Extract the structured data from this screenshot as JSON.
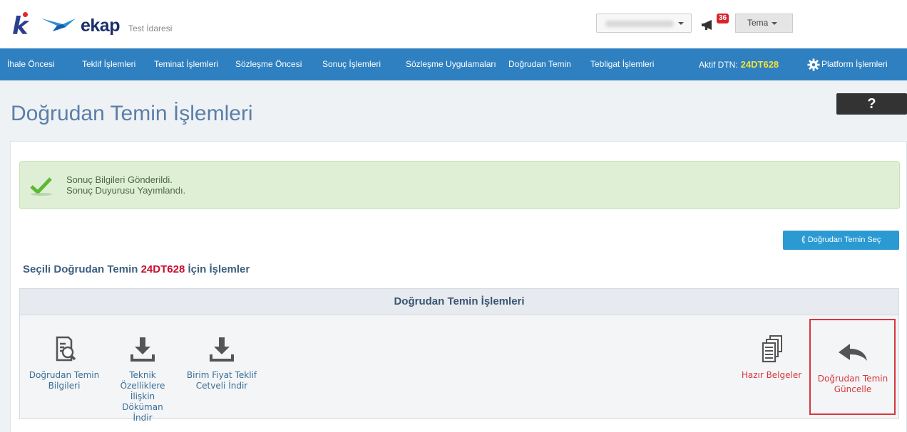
{
  "header": {
    "brand": "ekap",
    "org": "Test İdaresi",
    "notification_count": "36",
    "theme_label": "Tema"
  },
  "nav": {
    "items": [
      "İhale Öncesi",
      "Teklif İşlemleri",
      "Teminat İşlemleri",
      "Sözleşme Öncesi",
      "Sonuç İşlemleri",
      "Sözleşme Uygulamaları",
      "Doğrudan Temin",
      "Tebligat İşlemleri"
    ],
    "active_dtn_label": "Aktif DTN:",
    "active_dtn_value": "24DT628",
    "platform_label": "Platform İşlemleri"
  },
  "page": {
    "title": "Doğrudan Temin İşlemleri",
    "help": "?"
  },
  "alert": {
    "line1": "Sonuç Bilgileri Gönderildi.",
    "line2": "Sonuç Duyurusu Yayımlandı."
  },
  "select_button": "Doğrudan Temin Seç",
  "section": {
    "prefix": "Seçili Doğrudan Temin",
    "code": "24DT628",
    "suffix": "İçin İşlemler"
  },
  "ops": {
    "header": "Doğrudan Temin İşlemleri",
    "items": [
      {
        "l1": "Doğrudan Temin",
        "l2": "Bilgileri",
        "l3": "",
        "l4": "",
        "icon": "document-search-icon"
      },
      {
        "l1": "Teknik",
        "l2": "Özelliklere",
        "l3": "İlişkin Döküman",
        "l4": "İndir",
        "icon": "download-icon"
      },
      {
        "l1": "Birim Fiyat Teklif",
        "l2": "Cetveli İndir",
        "l3": "",
        "l4": "",
        "icon": "download-icon"
      },
      {
        "l1": "Hazır Belgeler",
        "l2": "",
        "l3": "",
        "l4": "",
        "icon": "documents-icon"
      },
      {
        "l1": "Doğrudan Temin",
        "l2": "Güncelle",
        "l3": "",
        "l4": "",
        "icon": "reply-arrow-icon"
      }
    ]
  },
  "colors": {
    "navbar": "#2f80c0",
    "title": "#5b7ea8",
    "accent_red": "#d9363e",
    "dtn_yellow": "#f4e03a"
  }
}
